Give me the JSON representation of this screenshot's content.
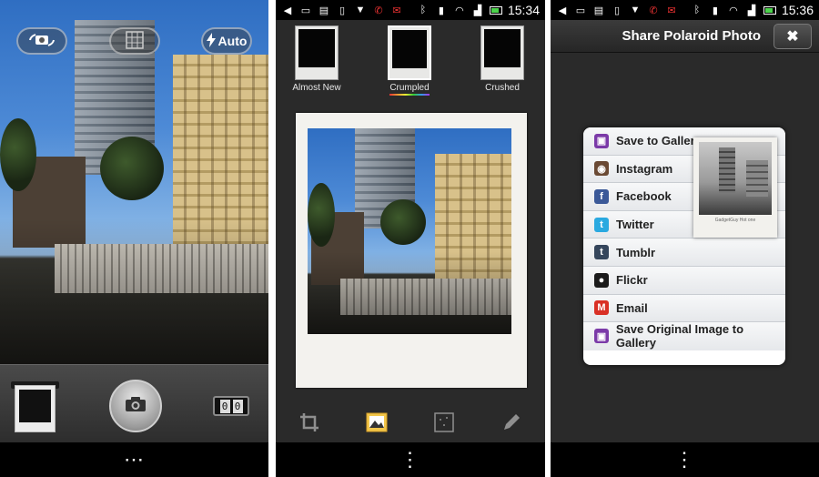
{
  "camera": {
    "flash_label": "Auto",
    "counter_digits": [
      "0",
      "0"
    ],
    "icons": [
      "switch-camera-icon",
      "grid-icon",
      "flash-icon",
      "shutter-camera-icon"
    ]
  },
  "status": {
    "time_edit": "15:34",
    "time_share": "15:36"
  },
  "editor": {
    "filters": [
      {
        "label": "Almost New",
        "selected": false
      },
      {
        "label": "Crumpled",
        "selected": true
      },
      {
        "label": "Crushed",
        "selected": false
      }
    ],
    "tools": [
      "crop-icon",
      "image-icon",
      "effects-icon",
      "pencil-icon"
    ]
  },
  "share": {
    "title": "Share Polaroid Photo",
    "close_symbol": "✖",
    "items": [
      {
        "label": "Save to Gallery",
        "icon": "gallery-icon",
        "color": "#7b3aa8"
      },
      {
        "label": "Instagram",
        "icon": "instagram-icon",
        "color": "#6b4a34"
      },
      {
        "label": "Facebook",
        "icon": "facebook-icon",
        "color": "#3b5998"
      },
      {
        "label": "Twitter",
        "icon": "twitter-icon",
        "color": "#2aa9e0"
      },
      {
        "label": "Tumblr",
        "icon": "tumblr-icon",
        "color": "#35465c"
      },
      {
        "label": "Flickr",
        "icon": "flickr-icon",
        "color": "#1b1b1b"
      },
      {
        "label": "Email",
        "icon": "email-icon",
        "color": "#d93025"
      },
      {
        "label": "Save Original Image to Gallery",
        "icon": "gallery-icon",
        "color": "#7b3aa8"
      }
    ],
    "preview_caption": "GadgetGuy Hot one"
  },
  "navbar": {
    "menu_symbol": "⋯",
    "menu_symbol_vertical": "⋮"
  }
}
